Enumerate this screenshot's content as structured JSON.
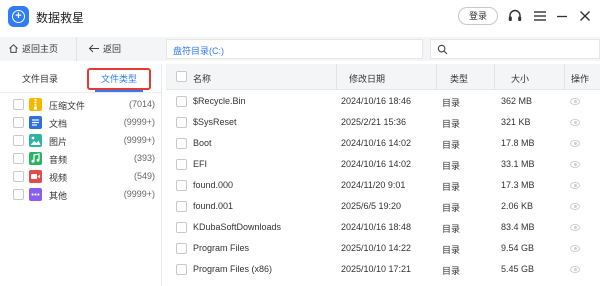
{
  "app": {
    "title": "数据救星",
    "login_label": "登录"
  },
  "nav": {
    "home_label": "返回主页",
    "back_label": "返回",
    "path": "盘符目录(C:)",
    "search_placeholder": ""
  },
  "left_tabs": {
    "directory_label": "文件目录",
    "type_label": "文件类型",
    "active": "type_label"
  },
  "file_types": [
    {
      "label": "压缩文件",
      "count": "(7014)",
      "icon": "zip-icon",
      "color": "#f5b800"
    },
    {
      "label": "文档",
      "count": "(9999+)",
      "icon": "document-icon",
      "color": "#2f6fe0"
    },
    {
      "label": "图片",
      "count": "(9999+)",
      "icon": "image-icon",
      "color": "#2db4a2"
    },
    {
      "label": "音频",
      "count": "(393)",
      "icon": "audio-icon",
      "color": "#28b463"
    },
    {
      "label": "视频",
      "count": "(549)",
      "icon": "video-icon",
      "color": "#e34a4a"
    },
    {
      "label": "其他",
      "count": "(9999+)",
      "icon": "other-icon",
      "color": "#8a5cf0"
    }
  ],
  "table": {
    "columns": {
      "name": "名称",
      "date": "修改日期",
      "type": "类型",
      "size": "大小",
      "action": "操作"
    },
    "rows": [
      {
        "name": "$Recycle.Bin",
        "date": "2024/10/16 18:46",
        "type": "目录",
        "size": "362 MB"
      },
      {
        "name": "$SysReset",
        "date": "2025/2/21 15:36",
        "type": "目录",
        "size": "321 KB"
      },
      {
        "name": "Boot",
        "date": "2024/10/16 14:02",
        "type": "目录",
        "size": "17.8 MB"
      },
      {
        "name": "EFI",
        "date": "2024/10/16 14:02",
        "type": "目录",
        "size": "33.1 MB"
      },
      {
        "name": "found.000",
        "date": "2024/11/20 9:01",
        "type": "目录",
        "size": "17.3 MB"
      },
      {
        "name": "found.001",
        "date": "2025/6/5 19:20",
        "type": "目录",
        "size": "2.06 KB"
      },
      {
        "name": "KDubaSoftDownloads",
        "date": "2024/10/16 18:48",
        "type": "目录",
        "size": "83.4 MB"
      },
      {
        "name": "Program Files",
        "date": "2025/10/10 14:22",
        "type": "目录",
        "size": "9.54 GB"
      },
      {
        "name": "Program Files (x86)",
        "date": "2025/10/10 17:21",
        "type": "目录",
        "size": "5.45 GB"
      }
    ]
  },
  "colors": {
    "accent": "#2f7cf6",
    "highlight_border": "#e53935",
    "header_bg": "#f4f5f7"
  }
}
